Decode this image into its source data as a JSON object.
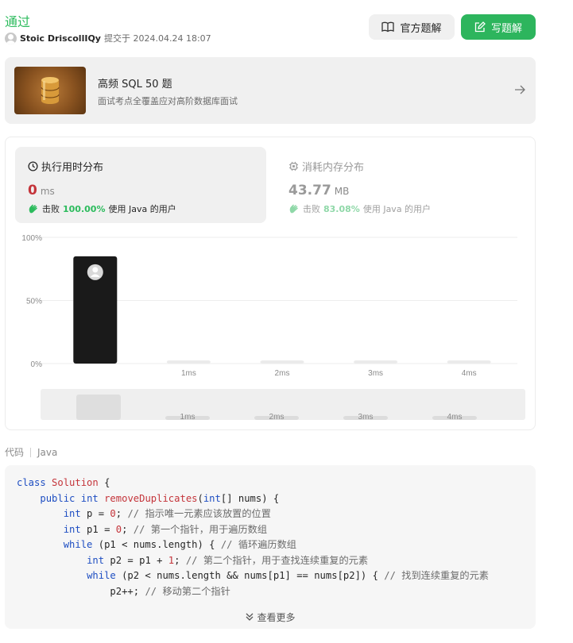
{
  "submission": {
    "status": "通过",
    "author": "Stoic DriscollIQy",
    "submitted_at": "提交于 2024.04.24 18:07"
  },
  "actions": {
    "official_solution": "官方题解",
    "write_solution": "写题解"
  },
  "study_plan": {
    "title": "高频 SQL 50 题",
    "subtitle": "面试考点全覆盖应对高阶数据库面试"
  },
  "runtime": {
    "title": "执行用时分布",
    "value": "0",
    "unit": "ms",
    "beats_label": "击败",
    "beats_pct": "100.00%",
    "beats_suffix": "使用 Java 的用户"
  },
  "memory": {
    "title": "消耗内存分布",
    "value": "43.77",
    "unit": "MB",
    "beats_label": "击败",
    "beats_pct": "83.08%",
    "beats_suffix": "使用 Java 的用户"
  },
  "chart_data": {
    "type": "bar",
    "categories": [
      "0ms",
      "1ms",
      "2ms",
      "3ms",
      "4ms"
    ],
    "tick_labels": [
      "",
      "1ms",
      "2ms",
      "3ms",
      "4ms"
    ],
    "values": [
      85,
      0.5,
      0.5,
      0.5,
      0.5
    ],
    "y_ticks": [
      "100%",
      "50%",
      "0%"
    ],
    "ylim": [
      0,
      100
    ],
    "highlight_index": 0,
    "colors": {
      "highlight": "#1a1a1a",
      "bar": "#ebebeb",
      "grid": "#eeeeee",
      "nav_bg": "#efefef",
      "nav_bar": "#dedede"
    }
  },
  "code_section": {
    "label": "代码",
    "language": "Java",
    "more": "查看更多",
    "lines": [
      "class Solution {",
      "    public int removeDuplicates(int[] nums) {",
      "        int p = 0; // 指示唯一元素应该放置的位置",
      "        int p1 = 0; // 第一个指针，用于遍历数组",
      "        while (p1 < nums.length) { // 循环遍历数组",
      "            int p2 = p1 + 1; // 第二个指针，用于查找连续重复的元素",
      "            while (p2 < nums.length && nums[p1] == nums[p2]) { // 找到连续重复的元素",
      "                p2++; // 移动第二个指针"
    ]
  }
}
